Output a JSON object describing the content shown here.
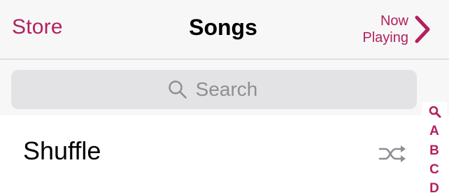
{
  "navbar": {
    "left_button": "Store",
    "title": "Songs",
    "right_button_line1": "Now",
    "right_button_line2": "Playing",
    "right_icon": "chevron-right-icon"
  },
  "search": {
    "placeholder": "Search",
    "icon": "search-icon"
  },
  "shuffle": {
    "label": "Shuffle",
    "icon": "shuffle-icon"
  },
  "index": {
    "search_icon": "search-icon",
    "letters": [
      "A",
      "B",
      "C",
      "D"
    ]
  },
  "colors": {
    "accent": "#b3205e",
    "navbar_bg": "#f7f7f7",
    "search_field_bg": "#e3e3e5",
    "placeholder": "#8e8e93"
  }
}
